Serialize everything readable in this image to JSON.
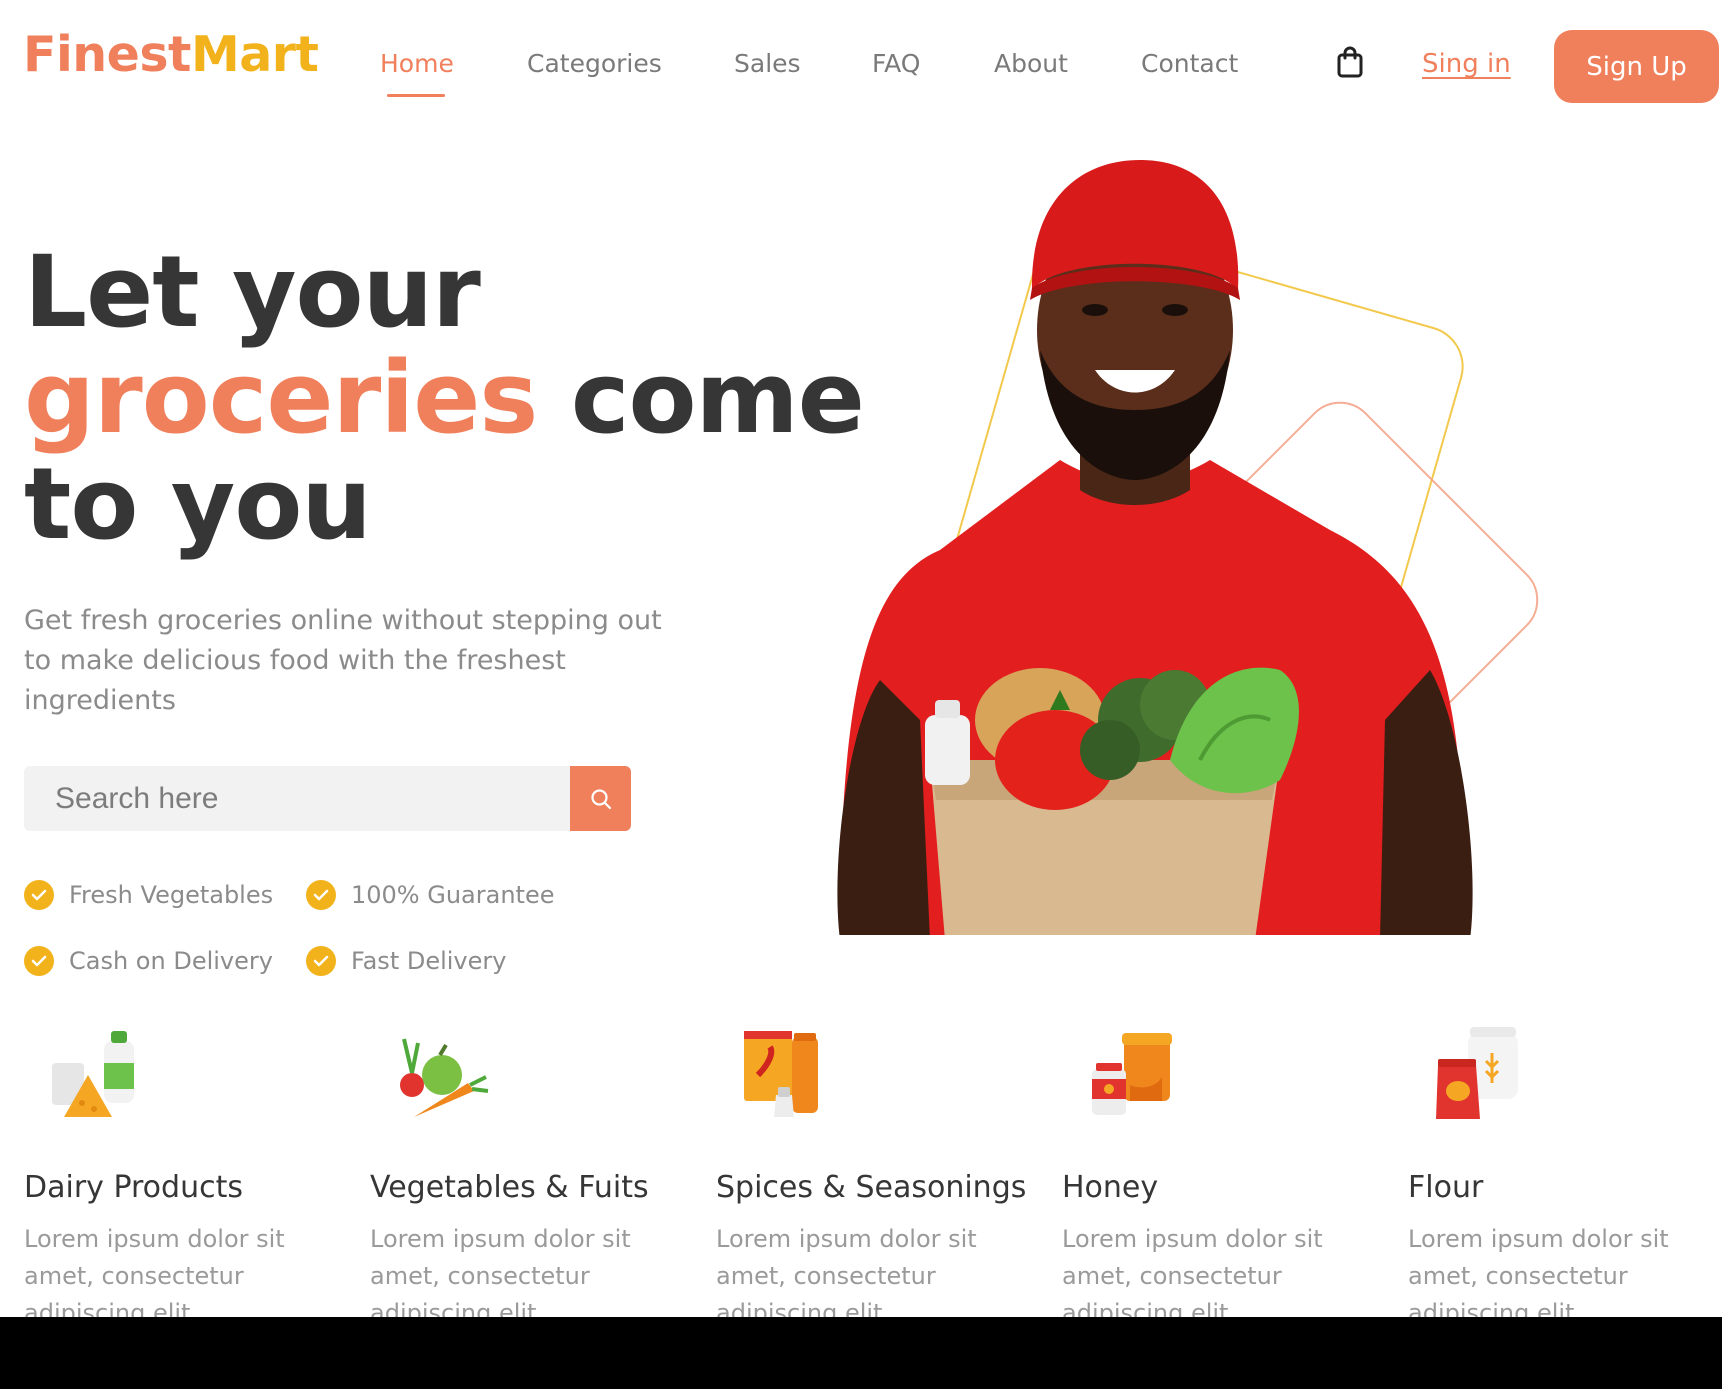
{
  "nav": {
    "logo_part1": "Finest",
    "logo_part2": "Mart",
    "links": [
      "Home",
      "Categories",
      "Sales",
      "FAQ",
      "About",
      "Contact"
    ],
    "active_link": "Home",
    "signin_label": "Sing in",
    "signup_label": "Sign Up"
  },
  "hero": {
    "title_line1": "Let your",
    "title_accent": "groceries",
    "title_line2_rest": " come",
    "title_line3": "to you",
    "subtitle": "Get fresh groceries online without stepping out to make delicious food with the freshest ingredients",
    "search_placeholder": "Search here",
    "features": [
      "Fresh Vegetables",
      "100% Guarantee",
      "Cash on Delivery",
      "Fast Delivery"
    ]
  },
  "categories": [
    {
      "title": "Dairy Products",
      "desc": "Lorem ipsum dolor sit amet, consectetur adipiscing elit.",
      "icon": "dairy-icon"
    },
    {
      "title": "Vegetables & Fuits",
      "desc": "Lorem ipsum dolor sit amet, consectetur adipiscing elit.",
      "icon": "vegetables-icon"
    },
    {
      "title": "Spices & Seasonings",
      "desc": "Lorem ipsum dolor sit amet, consectetur adipiscing elit.",
      "icon": "spices-icon"
    },
    {
      "title": "Honey",
      "desc": "Lorem ipsum dolor sit amet, consectetur adipiscing elit.",
      "icon": "honey-icon"
    },
    {
      "title": "Flour",
      "desc": "Lorem ipsum dolor sit amet, consectetur adipiscing elit.",
      "icon": "flour-icon"
    }
  ],
  "colors": {
    "accent": "#F07F5B",
    "yellow": "#F2B21B",
    "heading": "#363636",
    "muted": "#8b8b8b"
  }
}
